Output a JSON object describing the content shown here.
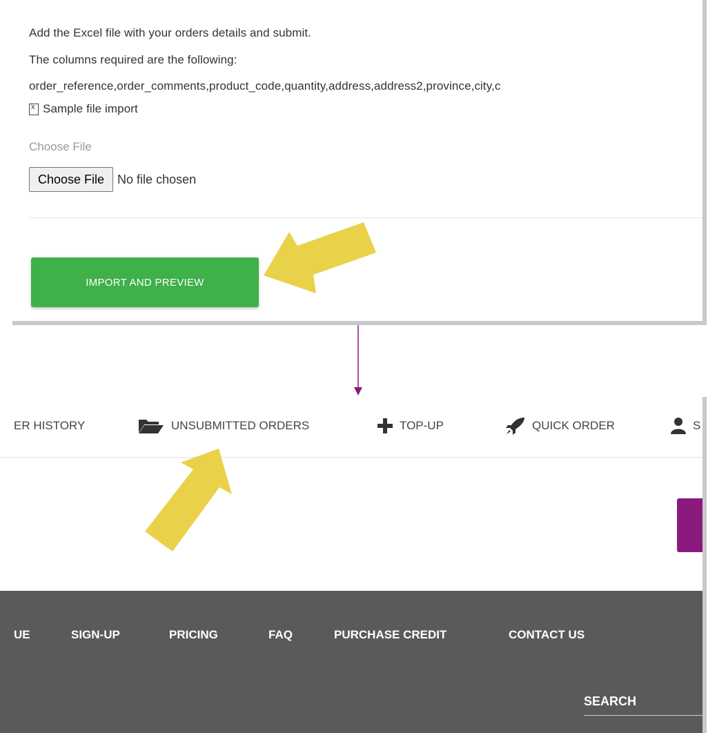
{
  "import_card": {
    "intro_line1": "Add the Excel file with your orders details and submit.",
    "intro_line2": "The columns required are the following:",
    "columns_line": "order_reference,order_comments,product_code,quantity,address,address2,province,city,c",
    "sample_link": "Sample file import",
    "sample_icon": "excel-file-icon",
    "file_label": "Choose File",
    "file_button": "Choose File",
    "file_status": "No file chosen",
    "import_button": "IMPORT AND PREVIEW"
  },
  "nav": {
    "items": [
      {
        "label": "ER HISTORY",
        "icon": ""
      },
      {
        "label": "UNSUBMITTED ORDERS",
        "icon": "folder-open-icon"
      },
      {
        "label": "TOP-UP",
        "icon": "plus-icon"
      },
      {
        "label": "QUICK ORDER",
        "icon": "rocket-icon"
      },
      {
        "label": "S",
        "icon": "user-icon"
      }
    ]
  },
  "footer": {
    "links": [
      "UE",
      "SIGN-UP",
      "PRICING",
      "FAQ",
      "PURCHASE CREDIT",
      "CONTACT US"
    ],
    "search_label": "SEARCH"
  },
  "colors": {
    "import_button": "#3fb04a",
    "highlight_arrow": "#e9d24a",
    "connector": "#8b1a7f",
    "footer_bg": "#5a5a59",
    "accent_purple": "#8b1a7f"
  }
}
